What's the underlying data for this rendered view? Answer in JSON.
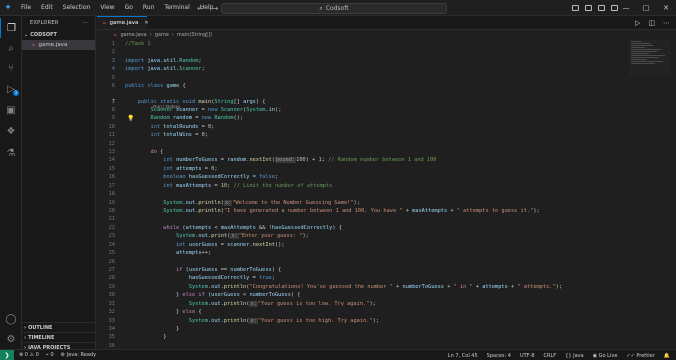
{
  "menu": [
    "File",
    "Edit",
    "Selection",
    "View",
    "Go",
    "Run",
    "Terminal",
    "Help"
  ],
  "search": {
    "text": "Codsoft"
  },
  "sidebar": {
    "title": "EXPLORER",
    "folder": "CODSOFT",
    "file": "game.java",
    "sections": [
      "OUTLINE",
      "TIMELINE",
      "JAVA PROJECTS"
    ]
  },
  "tab": {
    "label": "game.java"
  },
  "breadcrumb": {
    "file": "game.java",
    "class": "game",
    "method": "main(String[])"
  },
  "codelens": "Run | Debug",
  "status": {
    "errors": "0",
    "warnings": "0",
    "ports": "0",
    "java": "Java: Ready",
    "position": "Ln 7, Col 45",
    "spaces": "Spaces: 4",
    "encoding": "UTF-8",
    "eol": "CRLF",
    "language": "Java",
    "golive": "Go Live",
    "prettier": "Prettier"
  },
  "colors": {
    "accent": "#0078d4",
    "remote": "#16825d",
    "bulb": "#f5c518"
  },
  "code_lines": [
    {
      "n": "1",
      "t": "//Task 1"
    },
    {
      "n": "2",
      "t": ""
    },
    {
      "n": "3",
      "t": "import java.util.Random;"
    },
    {
      "n": "4",
      "t": "import java.util.Scanner;"
    },
    {
      "n": "5",
      "t": ""
    },
    {
      "n": "6",
      "t": "public class game {"
    },
    {
      "n": "7",
      "t": "    public static void main(String[] args) {"
    },
    {
      "n": "8",
      "t": "        Scanner scanner = new Scanner(System.in);"
    },
    {
      "n": "9",
      "t": "        Random random = new Random();"
    },
    {
      "n": "10",
      "t": "        int totalRounds = 0;"
    },
    {
      "n": "11",
      "t": "        int totalWins = 0;"
    },
    {
      "n": "12",
      "t": ""
    },
    {
      "n": "13",
      "t": "        do {"
    },
    {
      "n": "14",
      "t": "            int numberToGuess = random.nextInt(bound:100) + 1; // Random number between 1 and 100"
    },
    {
      "n": "15",
      "t": "            int attempts = 0;"
    },
    {
      "n": "16",
      "t": "            boolean hasGuessedCorrectly = false;"
    },
    {
      "n": "17",
      "t": "            int maxAttempts = 10; // Limit the number of attempts"
    },
    {
      "n": "18",
      "t": ""
    },
    {
      "n": "19",
      "t": "            System.out.println(x:\"Welcome to the Number Guessing Game!\");"
    },
    {
      "n": "20",
      "t": "            System.out.println(\"I have generated a number between 1 and 100. You have \" + maxAttempts + \" attempts to guess it.\");"
    },
    {
      "n": "21",
      "t": ""
    },
    {
      "n": "22",
      "t": "            while (attempts < maxAttempts && !hasGuessedCorrectly) {"
    },
    {
      "n": "23",
      "t": "                System.out.print(s:\"Enter your guess: \");"
    },
    {
      "n": "24",
      "t": "                int userGuess = scanner.nextInt();"
    },
    {
      "n": "25",
      "t": "                attempts++;"
    },
    {
      "n": "26",
      "t": ""
    },
    {
      "n": "27",
      "t": "                if (userGuess == numberToGuess) {"
    },
    {
      "n": "28",
      "t": "                    hasGuessedCorrectly = true;"
    },
    {
      "n": "29",
      "t": "                    System.out.println(\"Congratulations! You've guessed the number \" + numberToGuess + \" in \" + attempts + \" attempts.\");"
    },
    {
      "n": "30",
      "t": "                } else if (userGuess < numberToGuess) {"
    },
    {
      "n": "31",
      "t": "                    System.out.println(x:\"Your guess is too low. Try again.\");"
    },
    {
      "n": "32",
      "t": "                } else {"
    },
    {
      "n": "33",
      "t": "                    System.out.println(x:\"Your guess is too high. Try again.\");"
    },
    {
      "n": "34",
      "t": "                }"
    },
    {
      "n": "35",
      "t": "            }"
    },
    {
      "n": "36",
      "t": ""
    }
  ]
}
